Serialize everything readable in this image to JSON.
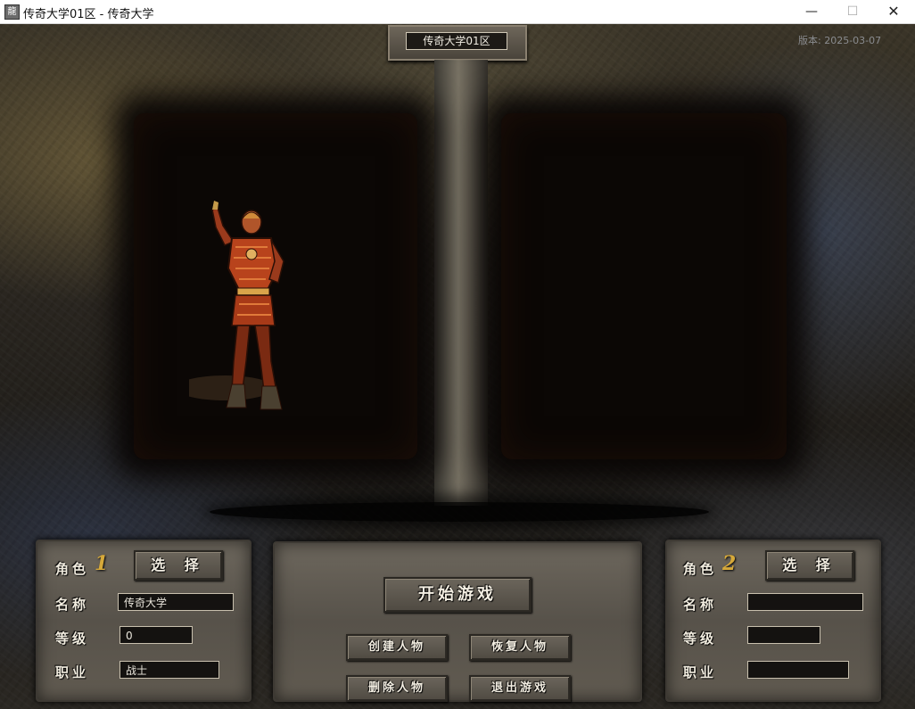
{
  "window": {
    "title": "传奇大学01区 - 传奇大学",
    "icon_char": "龍",
    "minimize": "—",
    "maximize": "☐",
    "close": "✕"
  },
  "header": {
    "server_name": "传奇大学01区",
    "version": "版本: 2025-03-07"
  },
  "slot1": {
    "role_label": "角色",
    "slot_number": "1",
    "select_label": "选 择",
    "name_label": "名称",
    "level_label": "等级",
    "job_label": "职业",
    "name_value": "传奇大学",
    "level_value": "0",
    "job_value": "战士"
  },
  "slot2": {
    "role_label": "角色",
    "slot_number": "2",
    "select_label": "选 择",
    "name_label": "名称",
    "level_label": "等级",
    "job_label": "职业",
    "name_value": "",
    "level_value": "",
    "job_value": ""
  },
  "actions": {
    "start_game": "开始游戏",
    "create_character": "创建人物",
    "restore_character": "恢复人物",
    "delete_character": "删除人物",
    "exit_game": "退出游戏"
  },
  "colors": {
    "slot_number": "#d6a93a",
    "panel_stone": "#5f594f",
    "label_text": "#f1ecdf"
  }
}
